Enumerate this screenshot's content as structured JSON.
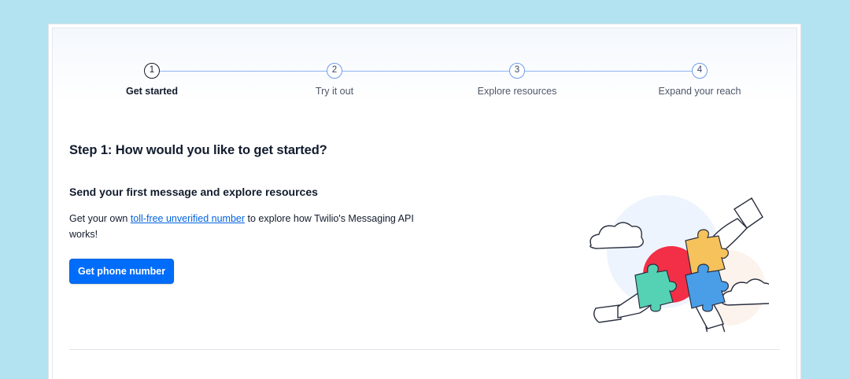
{
  "stepper": {
    "steps": [
      {
        "number": "1",
        "label": "Get started",
        "active": true
      },
      {
        "number": "2",
        "label": "Try it out",
        "active": false
      },
      {
        "number": "3",
        "label": "Explore resources",
        "active": false
      },
      {
        "number": "4",
        "label": "Expand your reach",
        "active": false
      }
    ]
  },
  "main": {
    "title": "Step 1: How would you like to get started?",
    "subtitle": "Send your first message and explore resources",
    "desc_before": "Get your own ",
    "desc_link": "toll-free unverified number",
    "desc_after": " to explore how Twilio's Messaging API works!",
    "button_label": "Get phone number"
  },
  "illustration": {
    "icon": "puzzle-hands-illustration"
  },
  "colors": {
    "page_bg": "#b3e3f1",
    "accent": "#006dfa",
    "link": "#0263e0",
    "step_line": "#8fb4f2",
    "puzzle_red": "#f22f46",
    "puzzle_yellow": "#f5c25b",
    "puzzle_green": "#55d2b4",
    "puzzle_blue": "#4a9ee8"
  }
}
